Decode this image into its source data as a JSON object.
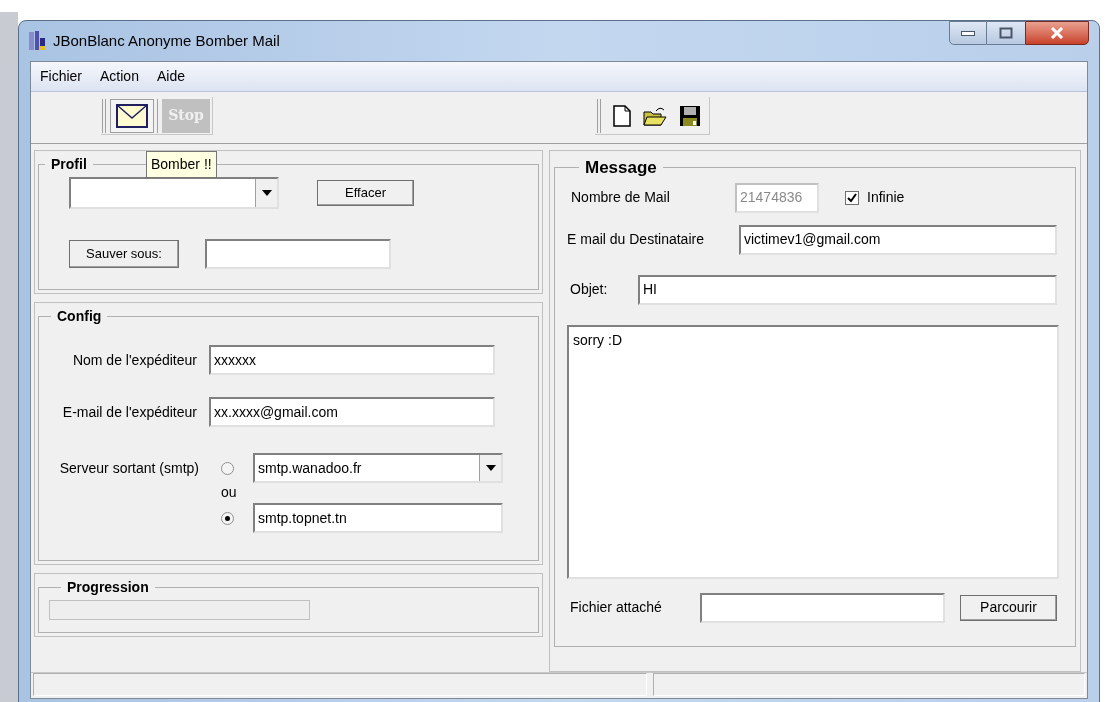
{
  "window": {
    "title": "JBonBlanc Anonyme Bomber Mail"
  },
  "menu": [
    "Fichier",
    "Action",
    "Aide"
  ],
  "toolbar": {
    "stop_button": {
      "label": "Stop",
      "disabled": true
    }
  },
  "tooltip": "Bomber !!",
  "profil": {
    "title": "Profil",
    "clear_button": "Effacer",
    "save_as_button": "Sauver sous:"
  },
  "config": {
    "title": "Config",
    "sender_name": {
      "label": "Nom de l'expéditeur",
      "value": "xxxxxx"
    },
    "sender_email": {
      "label": "E-mail de l'expéditeur",
      "value": "xx.xxxx@gmail.com"
    },
    "smtp_label": "Serveur sortant (smtp)",
    "or_label": "ou",
    "smtp_options": [
      {
        "kind": "dropdown",
        "value": "smtp.wanadoo.fr",
        "selected": false
      },
      {
        "kind": "text",
        "value": "smtp.topnet.tn",
        "selected": true
      }
    ]
  },
  "progression": {
    "title": "Progression",
    "level": 0
  },
  "message": {
    "title": "Message",
    "count": {
      "label": "Nombre de Mail",
      "value": "21474836",
      "disabled": true
    },
    "infinite": {
      "label": "Infinie",
      "checked": true
    },
    "recipient": {
      "label": "E mail du Destinataire",
      "value": "victimev1@gmail.com"
    },
    "subject": {
      "label": "Objet:",
      "value": "HI"
    },
    "body": "sorry :D",
    "attachment": {
      "label": "Fichier attaché",
      "button": "Parcourir"
    }
  }
}
